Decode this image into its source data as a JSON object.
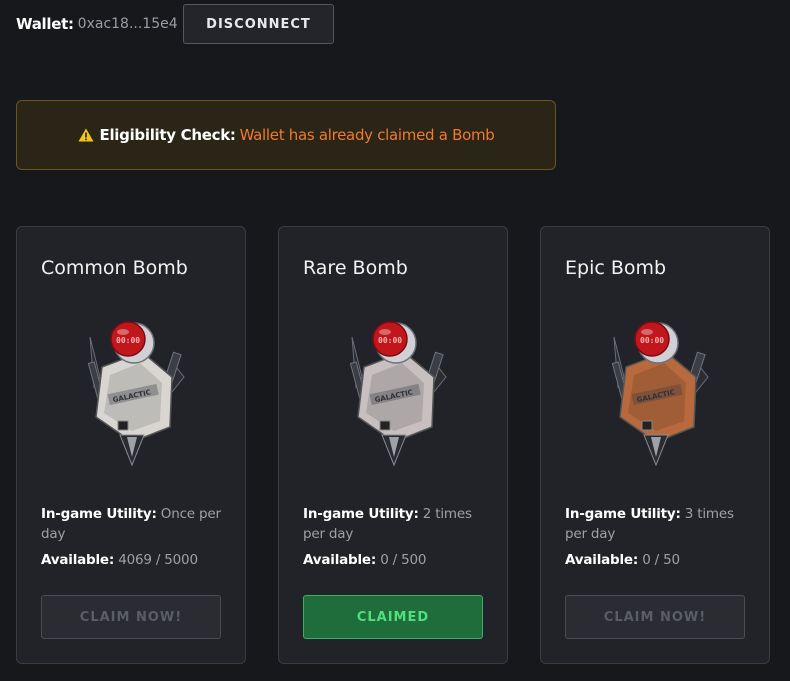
{
  "header": {
    "wallet_label": "Wallet:",
    "wallet_address": "0xac18...15e4",
    "disconnect_label": "DISCONNECT"
  },
  "alert": {
    "label": "Eligibility Check:",
    "message": "Wallet has already claimed a Bomb",
    "icon": "warning-icon"
  },
  "cards": [
    {
      "title": "Common Bomb",
      "utility_label": "In-game Utility:",
      "utility_value": "Once per day",
      "available_label": "Available:",
      "available_value": "4069 / 5000",
      "button_label": "CLAIM NOW!",
      "button_state": "disabled",
      "tint": "#d9d6d2"
    },
    {
      "title": "Rare Bomb",
      "utility_label": "In-game Utility:",
      "utility_value": "2 times per day",
      "available_label": "Available:",
      "available_value": "0 / 500",
      "button_label": "CLAIMED",
      "button_state": "claimed",
      "tint": "#c7bfc0"
    },
    {
      "title": "Epic Bomb",
      "utility_label": "In-game Utility:",
      "utility_value": "3 times per day",
      "available_label": "Available:",
      "available_value": "0 / 50",
      "button_label": "CLAIM NOW!",
      "button_state": "disabled",
      "tint": "#b86a3e"
    }
  ],
  "bomb_text": {
    "timer": "00:00",
    "brand": "GALACTIC"
  },
  "colors": {
    "background": "#17181c",
    "card": "#222328",
    "alert_text": "#ef7a2e",
    "claimed": "#4fe07e"
  }
}
